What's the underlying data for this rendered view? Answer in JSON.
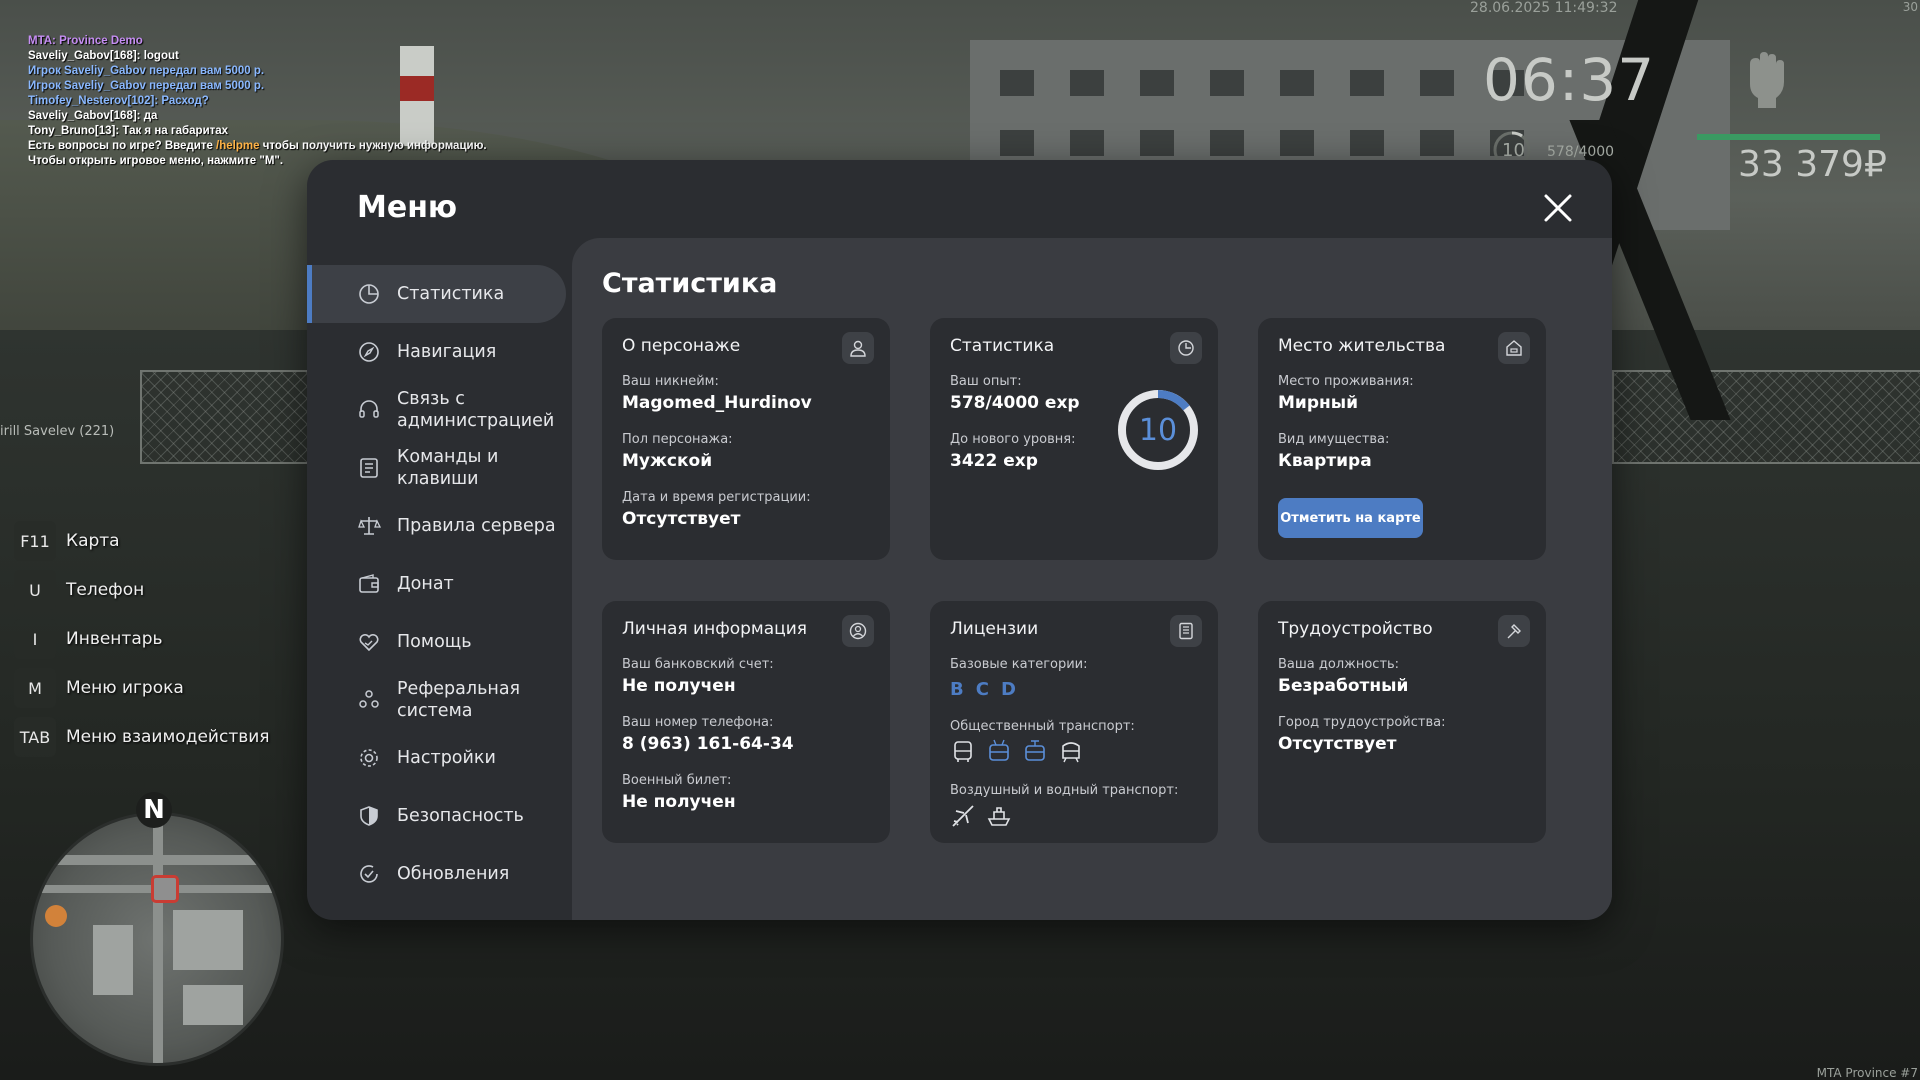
{
  "chat": [
    {
      "text": "MTA: Province Demo",
      "color": "purple"
    },
    {
      "text": "Saveliy_Gabov[168]: logout",
      "color": "white"
    },
    {
      "text": "Игрок Saveliy_Gabov передал вам 5000 р.",
      "color": "blue"
    },
    {
      "text": "Игрок Saveliy_Gabov передал вам 5000 р.",
      "color": "blue"
    },
    {
      "text": "Timofey_Nesterov[102]: Расход?",
      "color": "blue"
    },
    {
      "text": "Saveliy_Gabov[168]: да",
      "color": "white"
    },
    {
      "text": "Tony_Bruno[13]: Так я на габаритах",
      "color": "white"
    },
    {
      "text_pre": "Есть вопросы по игре? Введите ",
      "text_cmd": "/helpme",
      "text_post": " чтобы получить нужную информацию.",
      "color": "white"
    },
    {
      "text": "Чтобы открыть игровое меню, нажмите \"M\".",
      "color": "white"
    }
  ],
  "hud": {
    "datetime": "28.06.2025 11:49:32",
    "corner": "30",
    "time": "06:37",
    "level": "10",
    "exp": "578/4000",
    "money": "33 379₽",
    "nick_tag": "irill Savelev (221)",
    "watermark": "MTA Province #7",
    "minimap_north": "N",
    "colors": {
      "health_bar": "#3a9a62"
    }
  },
  "hotkeys": [
    {
      "key": "F11",
      "label": "Карта"
    },
    {
      "key": "U",
      "label": "Телефон"
    },
    {
      "key": "I",
      "label": "Инвентарь"
    },
    {
      "key": "M",
      "label": "Меню игрока"
    },
    {
      "key": "TAB",
      "label": "Меню взаимодействия"
    }
  ],
  "menu": {
    "title": "Меню",
    "close_icon": "close-icon",
    "accent": "#4d7cc3",
    "nav": [
      {
        "label": "Статистика",
        "icon": "pie-chart-icon",
        "active": true
      },
      {
        "label": "Навигация",
        "icon": "compass-icon"
      },
      {
        "label": "Связь с администрацией",
        "icon": "headset-icon"
      },
      {
        "label": "Команды и клавиши",
        "icon": "list-icon"
      },
      {
        "label": "Правила сервера",
        "icon": "scales-icon"
      },
      {
        "label": "Донат",
        "icon": "wallet-icon"
      },
      {
        "label": "Помощь",
        "icon": "heart-hand-icon"
      },
      {
        "label": "Реферальная система",
        "icon": "people-icon"
      },
      {
        "label": "Настройки",
        "icon": "gear-icon"
      },
      {
        "label": "Безопасность",
        "icon": "shield-icon"
      },
      {
        "label": "Обновления",
        "icon": "refresh-check-icon"
      }
    ],
    "content_title": "Статистика",
    "cards": {
      "character": {
        "title": "О персонаже",
        "icon": "user-icon",
        "nickname_label": "Ваш никнейм:",
        "nickname": "Magomed_Hurdinov",
        "gender_label": "Пол персонажа:",
        "gender": "Мужской",
        "reg_label": "Дата и время регистрации:",
        "reg": "Отсутствует"
      },
      "stats": {
        "title": "Статистика",
        "icon": "clock-pie-icon",
        "exp_label": "Ваш опыт:",
        "exp": "578/4000 exp",
        "next_label": "До нового уровня:",
        "next": "3422 exp",
        "level": "10",
        "progress": 0.1445
      },
      "residence": {
        "title": "Место жительства",
        "icon": "house-icon",
        "place_label": "Место проживания:",
        "place": "Мирный",
        "property_label": "Вид имущества:",
        "property": "Квартира",
        "button": "Отметить на карте"
      },
      "personal": {
        "title": "Личная информация",
        "icon": "user-circle-icon",
        "bank_label": "Ваш банковский счет:",
        "bank": "Не получен",
        "phone_label": "Ваш номер телефона:",
        "phone": "8 (963) 161-64-34",
        "military_label": "Военный билет:",
        "military": "Не получен"
      },
      "licenses": {
        "title": "Лицензии",
        "icon": "document-icon",
        "base_label": "Базовые категории:",
        "base": [
          "B",
          "C",
          "D"
        ],
        "public_label": "Общественный транспорт:",
        "public_icons": [
          "bus-icon",
          "trolleybus-icon",
          "tram-icon",
          "metro-icon"
        ],
        "air_label": "Воздушный и водный транспорт:",
        "air_icons": [
          "plane-icon",
          "ship-icon"
        ]
      },
      "job": {
        "title": "Трудоустройство",
        "icon": "hammer-icon",
        "position_label": "Ваша должность:",
        "position": "Безработный",
        "city_label": "Город трудоустройства:",
        "city": "Отсутствует"
      }
    }
  }
}
